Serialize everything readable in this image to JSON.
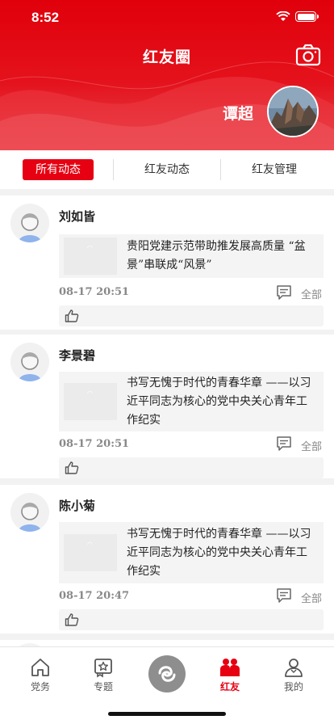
{
  "status": {
    "time": "8:52"
  },
  "header": {
    "title": "红友圈",
    "username": "谭超"
  },
  "tabs": [
    {
      "label": "所有动态",
      "active": true
    },
    {
      "label": "红友动态",
      "active": false
    },
    {
      "label": "红友管理",
      "active": false
    }
  ],
  "posts": [
    {
      "author": "刘如皆",
      "text": "贵阳党建示范带助推发展高质量 “盆景”串联成“风景”",
      "time": "08-17 20:51",
      "all_label": "全部"
    },
    {
      "author": "李景碧",
      "text": "书写无愧于时代的青春华章 ——以习近平同志为核心的党中央关心青年工作纪实",
      "time": "08-17 20:51",
      "all_label": "全部"
    },
    {
      "author": "陈小菊",
      "text": "书写无愧于时代的青春华章 ——以习近平同志为核心的党中央关心青年工作纪实",
      "time": "08-17 20:47",
      "all_label": "全部"
    }
  ],
  "nav": [
    {
      "label": "党务",
      "icon": "home-icon"
    },
    {
      "label": "专题",
      "icon": "star-badge-icon"
    },
    {
      "label": "",
      "icon": "center-logo-icon"
    },
    {
      "label": "红友",
      "icon": "group-icon",
      "active": true
    },
    {
      "label": "我的",
      "icon": "person-icon"
    }
  ],
  "colors": {
    "brand_red": "#e60012",
    "background": "#f2f2f2"
  }
}
